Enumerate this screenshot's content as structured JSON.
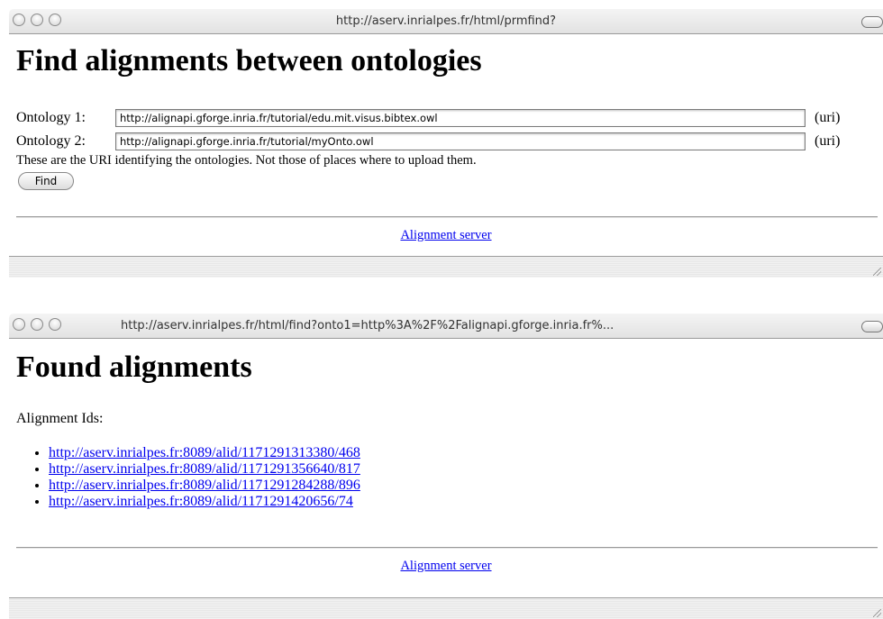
{
  "window1": {
    "url": "http://aserv.inrialpes.fr/html/prmfind?",
    "heading": "Find alignments between ontologies",
    "ontology1": {
      "label": "Ontology 1:",
      "value": "http://alignapi.gforge.inria.fr/tutorial/edu.mit.visus.bibtex.owl",
      "suffix": "(uri)"
    },
    "ontology2": {
      "label": "Ontology 2:",
      "value": "http://alignapi.gforge.inria.fr/tutorial/myOnto.owl",
      "suffix": "(uri)"
    },
    "hint": "These are the URI identifying the ontologies. Not those of places where to upload them.",
    "find_button": "Find",
    "footer_link": "Alignment server"
  },
  "window2": {
    "url": "http://aserv.inrialpes.fr/html/find?onto1=http%3A%2F%2Falignapi.gforge.inria.fr%...",
    "heading": "Found alignments",
    "ids_label": "Alignment Ids:",
    "alignment_ids": [
      "http://aserv.inrialpes.fr:8089/alid/1171291313380/468",
      "http://aserv.inrialpes.fr:8089/alid/1171291356640/817",
      "http://aserv.inrialpes.fr:8089/alid/1171291284288/896",
      "http://aserv.inrialpes.fr:8089/alid/1171291420656/74"
    ],
    "footer_link": "Alignment server"
  },
  "colors": {
    "link": "#0000ee",
    "titlebar": "#e8e8e8"
  }
}
